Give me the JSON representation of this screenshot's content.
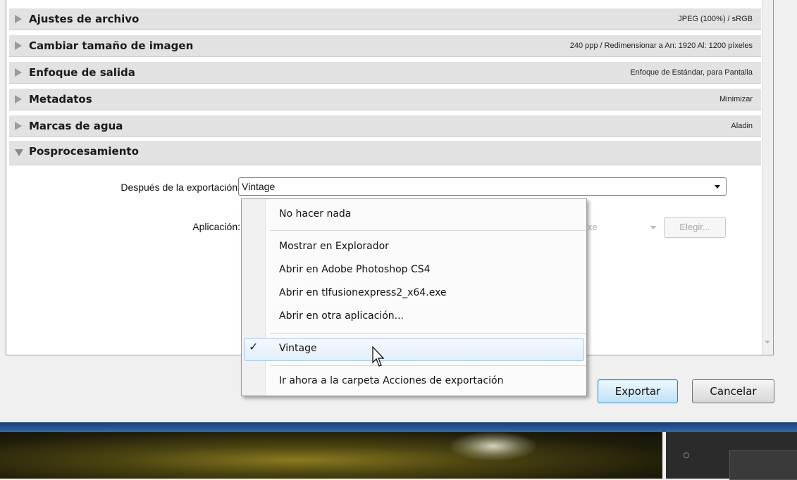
{
  "sections": [
    {
      "title": "Ajustes de archivo",
      "summary": "JPEG (100%) / sRGB",
      "expanded": false
    },
    {
      "title": "Cambiar tamaño de imagen",
      "summary": "240 ppp / Redimensionar a An: 1920 Al: 1200 píxeles",
      "expanded": false
    },
    {
      "title": "Enfoque de salida",
      "summary": "Enfoque de Estándar, para Pantalla",
      "expanded": false
    },
    {
      "title": "Metadatos",
      "summary": "Minimizar",
      "expanded": false
    },
    {
      "title": "Marcas de agua",
      "summary": "Aladin",
      "expanded": false
    },
    {
      "title": "Posprocesamiento",
      "summary": "",
      "expanded": true
    }
  ],
  "postprocessing": {
    "after_export_label": "Después de la exportación:",
    "after_export_value": "Vintage",
    "application_label": "Aplicación:",
    "application_value_partial": "xe",
    "choose_button": "Elegir..."
  },
  "dropdown": {
    "items": [
      "No hacer nada",
      "Mostrar en Explorador",
      "Abrir en Adobe Photoshop CS4",
      "Abrir en tlfusionexpress2_x64.exe",
      "Abrir en otra aplicación...",
      "Vintage",
      "Ir ahora a la carpeta Acciones de exportación"
    ],
    "selected": "Vintage",
    "check_glyph": "✓"
  },
  "buttons": {
    "export": "Exportar",
    "cancel": "Cancelar"
  }
}
